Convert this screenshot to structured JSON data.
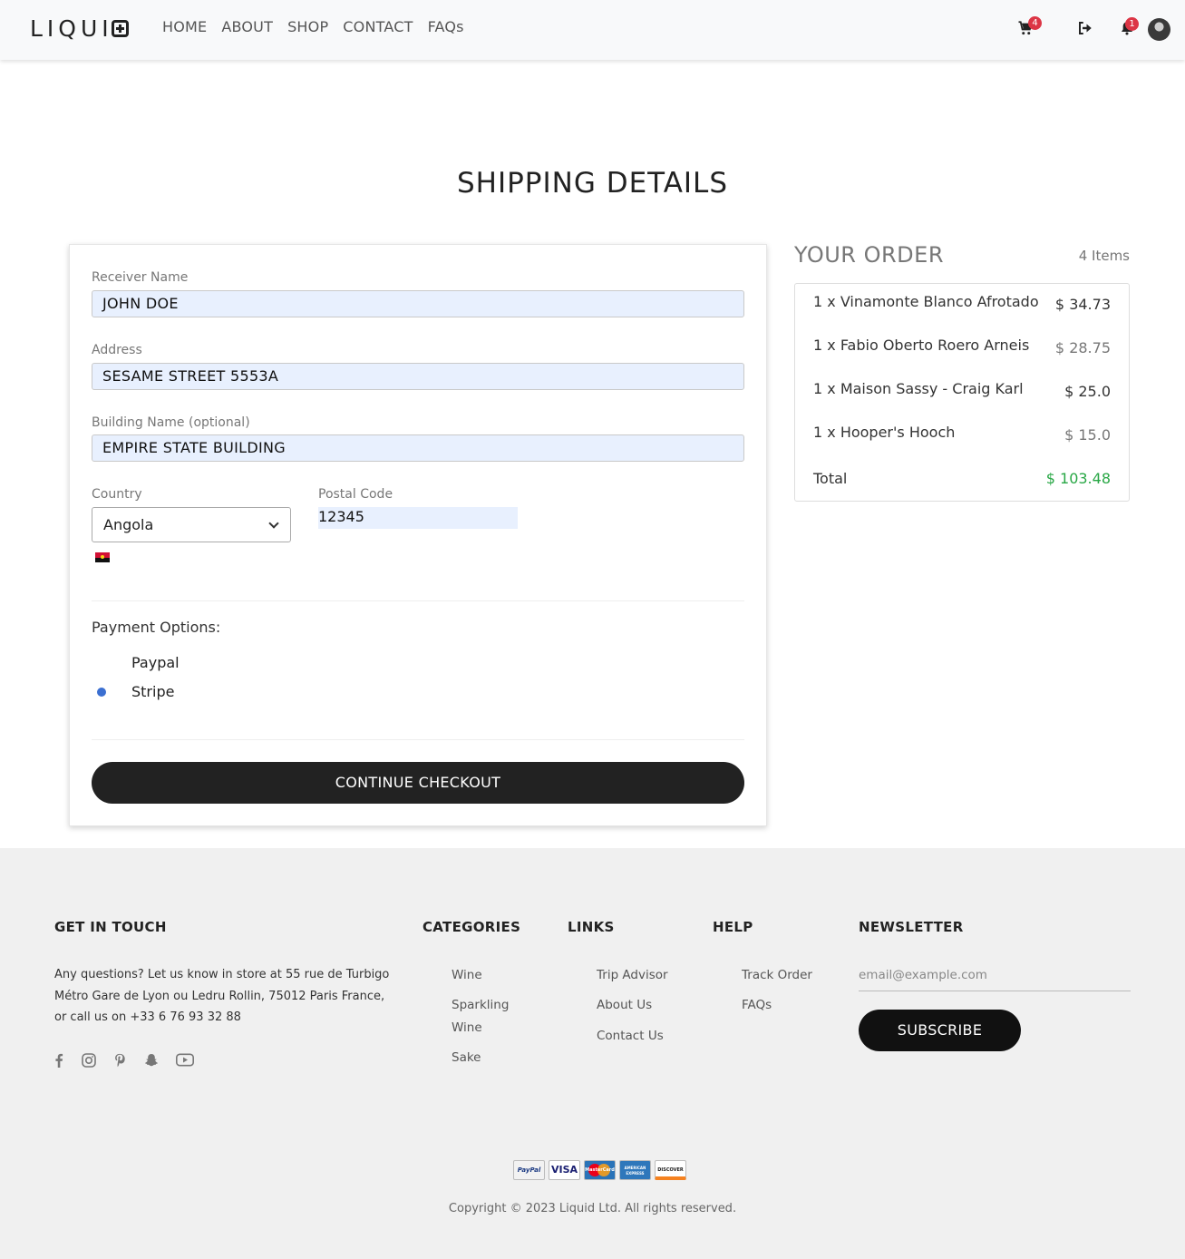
{
  "header": {
    "logo": "LIQUI",
    "nav": [
      "HOME",
      "ABOUT",
      "SHOP",
      "CONTACT",
      "FAQs"
    ],
    "cart_count": "4",
    "notif_count": "1"
  },
  "page_title": "SHIPPING DETAILS",
  "form": {
    "receiver_label": "Receiver Name",
    "receiver_value": "JOHN DOE",
    "address_label": "Address",
    "address_value": "SESAME STREET 5553A",
    "building_label": "Building Name (optional)",
    "building_value": "EMPIRE STATE BUILDING",
    "country_label": "Country",
    "country_value": "Angola",
    "postal_label": "Postal Code",
    "postal_value": "12345",
    "payment_title": "Payment Options:",
    "payment_options": [
      "Paypal",
      "Stripe"
    ],
    "selected_payment": "Stripe",
    "continue_label": "CONTINUE CHECKOUT"
  },
  "order": {
    "title": "YOUR ORDER",
    "count": "4 Items",
    "items": [
      {
        "name": "1 x Vinamonte Blanco Afrotado",
        "price": "$ 34.73"
      },
      {
        "name": "1 x Fabio Oberto Roero Arneis",
        "price": "$ 28.75"
      },
      {
        "name": "1 x Maison Sassy - Craig Karl",
        "price": "$ 25.0"
      },
      {
        "name": "1 x Hooper's Hooch",
        "price": "$ 15.0"
      }
    ],
    "total_label": "Total",
    "total_value": "$ 103.48"
  },
  "footer": {
    "get_in_touch": "GET IN TOUCH",
    "contact_text": "Any questions? Let us know in store at 55 rue de Turbigo Métro Gare de Lyon ou Ledru Rollin, 75012 Paris France, or call us on +33 6 76 93 32 88",
    "categories_title": "CATEGORIES",
    "categories": [
      "Wine",
      "Sparkling Wine",
      "Sake"
    ],
    "links_title": "LINKS",
    "links": [
      "Trip Advisor",
      "About Us",
      "Contact Us"
    ],
    "help_title": "HELP",
    "help": [
      "Track Order",
      "FAQs"
    ],
    "newsletter_title": "NEWSLETTER",
    "email_placeholder": "email@example.com",
    "subscribe_label": "SUBSCRIBE",
    "payment_cards": [
      "PayPal",
      "VISA",
      "MasterCard",
      "AMERICAN EXPRESS",
      "DISCOVER"
    ],
    "copyright": "Copyright © 2023 Liquid Ltd. All rights reserved."
  }
}
